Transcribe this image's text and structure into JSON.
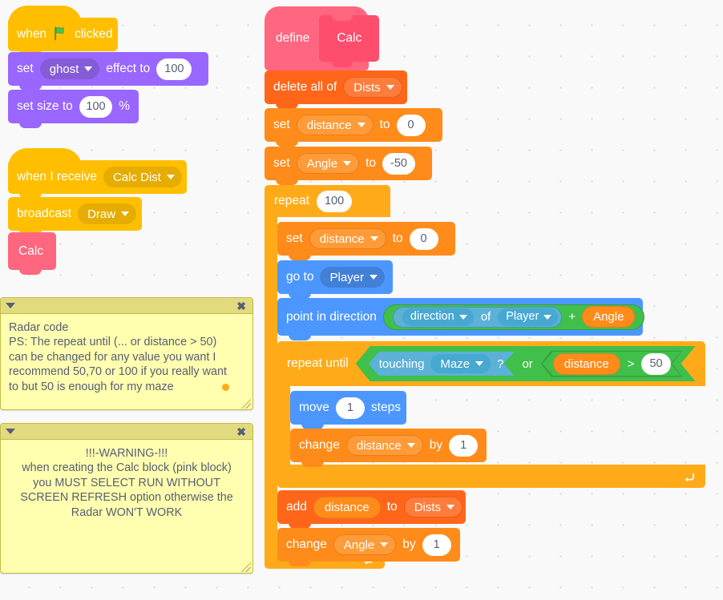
{
  "workspace": {
    "background_color": "#f9f9f9",
    "grid_dot_color": "#d9d9d9"
  },
  "scripts": {
    "flag_script": {
      "hat": {
        "prefix": "when",
        "icon": "green-flag-icon",
        "suffix": "clicked"
      },
      "set_effect": {
        "label": "set",
        "effect": "ghost",
        "mid": "effect to",
        "value": "100"
      },
      "set_size": {
        "label": "set size to",
        "value": "100",
        "unit": "%"
      }
    },
    "receive_script": {
      "hat": {
        "label": "when I receive",
        "message": "Calc Dist"
      },
      "broadcast": {
        "label": "broadcast",
        "message": "Draw"
      },
      "call": {
        "label": "Calc"
      }
    },
    "define_script": {
      "define": {
        "label": "define",
        "proto": "Calc"
      },
      "delete_all": {
        "label": "delete all of",
        "list": "Dists"
      },
      "set_distance_outer": {
        "label": "set",
        "variable": "distance",
        "mid": "to",
        "value": "0"
      },
      "set_angle": {
        "label": "set",
        "variable": "Angle",
        "mid": "to",
        "value": "-50"
      },
      "repeat": {
        "label": "repeat",
        "times": "100"
      },
      "set_distance_inner": {
        "label": "set",
        "variable": "distance",
        "mid": "to",
        "value": "0"
      },
      "go_to": {
        "label": "go to",
        "target": "Player"
      },
      "point_in_direction": {
        "label": "point in direction",
        "property": "direction",
        "of": "of",
        "object": "Player",
        "operator": "+",
        "variable": "Angle"
      },
      "repeat_until": {
        "label": "repeat until",
        "touching_label": "touching",
        "touching_target": "Maze",
        "question": "?",
        "or": "or",
        "variable": "distance",
        "comparator": ">",
        "threshold": "50"
      },
      "move": {
        "label": "move",
        "steps": "1",
        "suffix": "steps"
      },
      "change_distance": {
        "label": "change",
        "variable": "distance",
        "mid": "by",
        "value": "1"
      },
      "add_to_list": {
        "label": "add",
        "variable": "distance",
        "mid": "to",
        "list": "Dists"
      },
      "change_angle": {
        "label": "change",
        "variable": "Angle",
        "mid": "by",
        "value": "1"
      }
    }
  },
  "comments": [
    {
      "name": "radar-code-comment",
      "text": "Radar code\nPS: The repeat until (... or distance > 50)\ncan be changed for any value you want I\nrecommend 50,70 or 100 if you really want\nto but 50 is enough for my maze",
      "close_icon": "✖",
      "collapse_icon": "triangle-down-icon"
    },
    {
      "name": "warning-comment",
      "text": "!!!-WARNING-!!!\nwhen creating the Calc block (pink block)\nyou MUST SELECT RUN WITHOUT\nSCREEN REFRESH option otherwise the\nRadar WON'T WORK",
      "close_icon": "✖",
      "collapse_icon": "triangle-down-icon"
    }
  ],
  "palette": {
    "events": "#FFBF00",
    "looks": "#9966FF",
    "motion": "#4C97FF",
    "control": "#FFAB19",
    "variables": "#FF8C1A",
    "lists": "#FF661A",
    "custom": "#FF6680",
    "operators": "#40BF4A",
    "sensing": "#5CB1D6",
    "comment_body": "#FFFFAF",
    "comment_header": "#E2DA7F"
  }
}
